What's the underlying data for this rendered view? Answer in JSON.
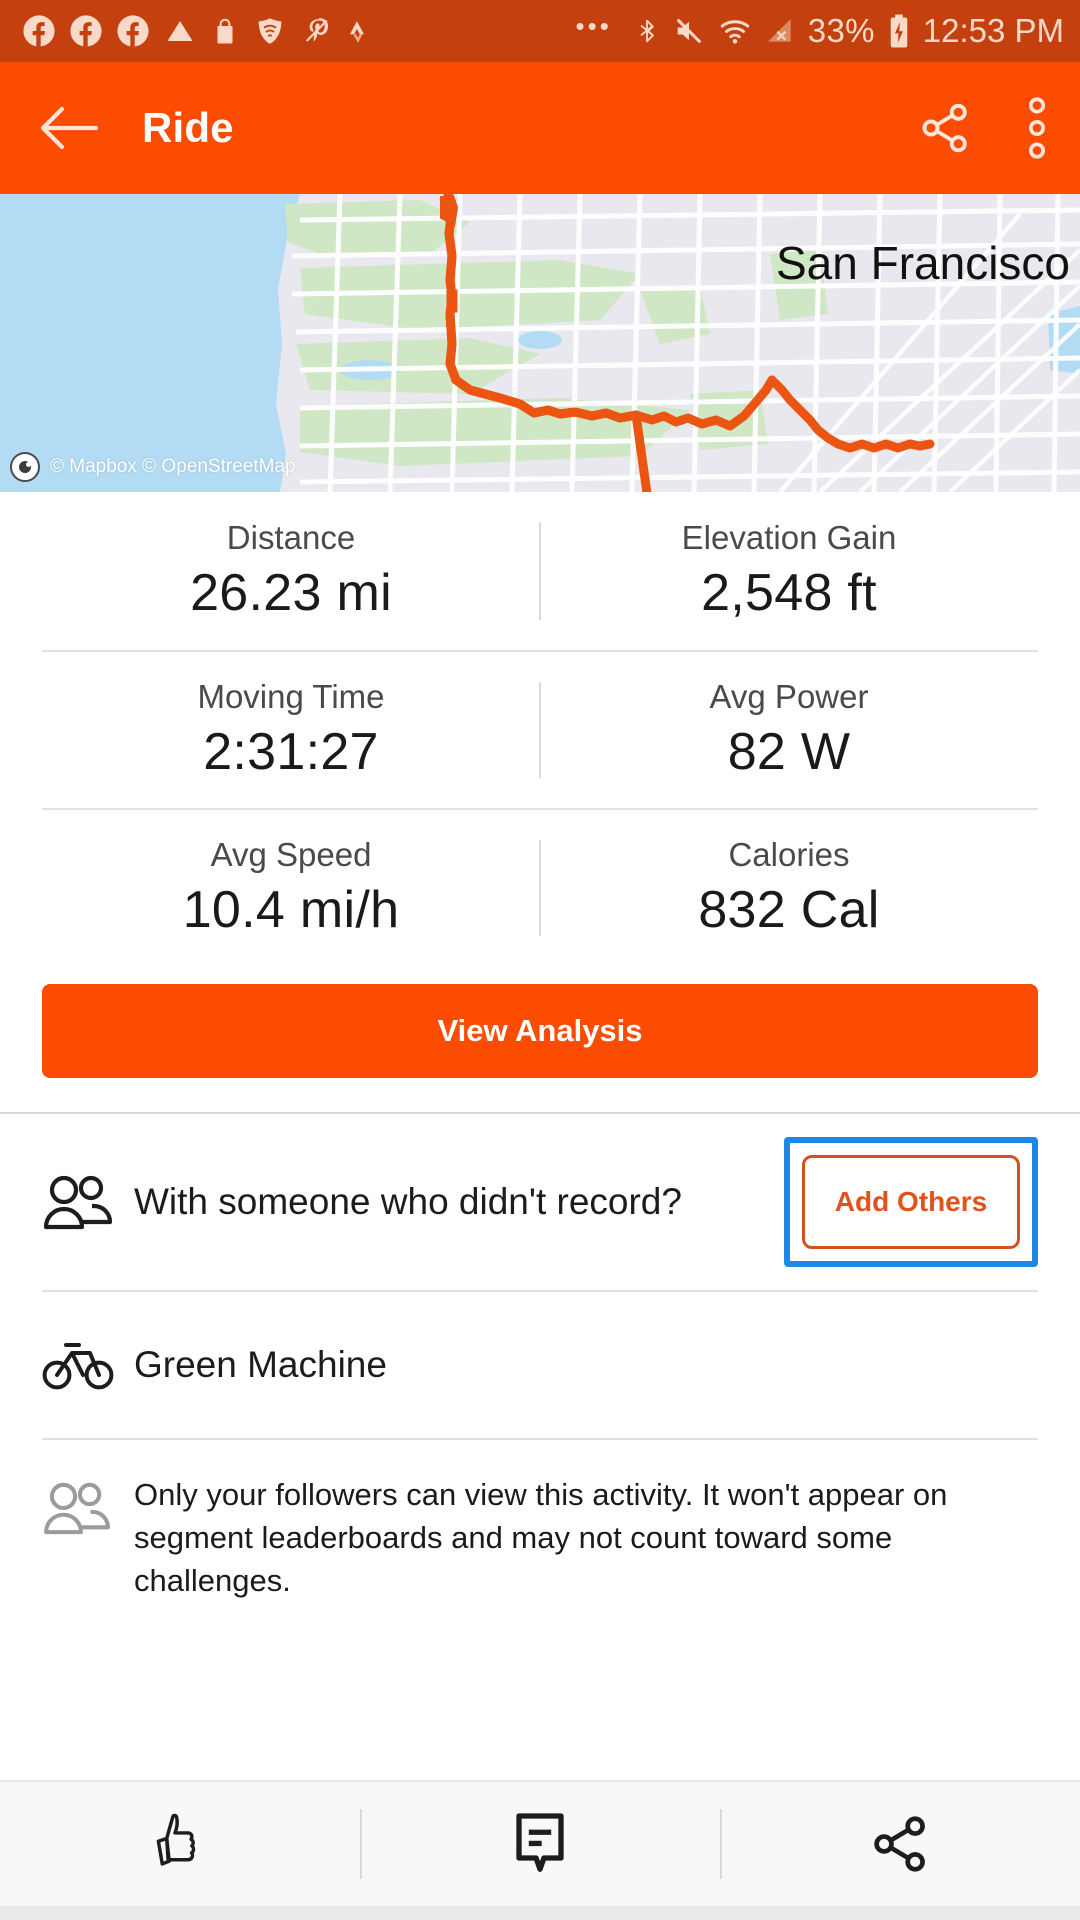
{
  "status_bar": {
    "icons": [
      "facebook-icon",
      "facebook-icon",
      "facebook-icon",
      "triangle-icon",
      "shopping-bag-icon",
      "shield-wifi-icon",
      "pinterest-icon",
      "strava-icon"
    ],
    "overflow_dots": "•••",
    "bluetooth_icon": "bluetooth-icon",
    "volume_muted_icon": "volume-muted-icon",
    "wifi_icon": "wifi-icon",
    "signal_icon": "signal-no-service-icon",
    "battery_percent": "33%",
    "battery_icon": "battery-charging-icon",
    "time": "12:53 PM"
  },
  "app_bar": {
    "back_icon": "back-arrow-icon",
    "title": "Ride",
    "share_icon": "share-icon",
    "overflow_icon": "more-vertical-icon"
  },
  "map": {
    "city_label": "San Francisco",
    "attribution": "© Mapbox © OpenStreetMap",
    "logo_icon": "mapbox-logo-icon",
    "route_color": "#ec5411"
  },
  "stats": {
    "rows": [
      [
        {
          "label": "Distance",
          "value": "26.23 mi"
        },
        {
          "label": "Elevation Gain",
          "value": "2,548 ft"
        }
      ],
      [
        {
          "label": "Moving Time",
          "value": "2:31:27"
        },
        {
          "label": "Avg Power",
          "value": "82 W"
        }
      ],
      [
        {
          "label": "Avg Speed",
          "value": "10.4 mi/h"
        },
        {
          "label": "Calories",
          "value": "832 Cal"
        }
      ]
    ]
  },
  "analysis": {
    "label": "View Analysis"
  },
  "add_others_row": {
    "icon": "people-icon",
    "text": "With someone who didn't record?",
    "button_label": "Add Others",
    "highlight_color": "#1e88e5"
  },
  "gear_row": {
    "icon": "bicycle-icon",
    "text": "Green Machine"
  },
  "privacy_row": {
    "icon": "people-icon",
    "text": "Only your followers can view this activity. It won't appear on segment leaderboards and may not count toward some challenges."
  },
  "bottom_bar": {
    "kudos_icon": "thumbs-up-icon",
    "comment_icon": "comment-icon",
    "share_icon": "share-icon"
  },
  "colors": {
    "status_bar": "#c4400e",
    "app_bar": "#fc4c02",
    "accent": "#fc4c02",
    "highlight": "#1e88e5"
  }
}
